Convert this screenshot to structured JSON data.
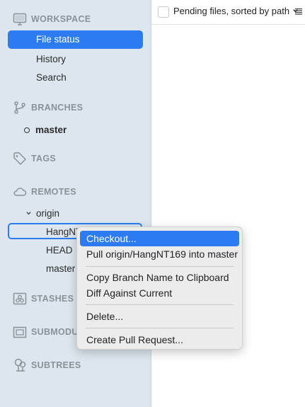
{
  "sidebar": {
    "workspace": {
      "header": "WORKSPACE",
      "items": [
        "File status",
        "History",
        "Search"
      ]
    },
    "branches": {
      "header": "BRANCHES",
      "current": "master"
    },
    "tags": {
      "header": "TAGS"
    },
    "remotes": {
      "header": "REMOTES",
      "remote_name": "origin",
      "branches": [
        "HangNT169",
        "HEAD",
        "master"
      ],
      "truncated_first": "HangNT"
    },
    "stashes": {
      "header": "STASHES"
    },
    "submodules": {
      "header": "SUBMODULES",
      "truncated": "SUBMODUL"
    },
    "subtrees": {
      "header": "SUBTREES"
    }
  },
  "toolbar": {
    "sort_label": "Pending files, sorted by path"
  },
  "context_menu": {
    "items": [
      "Checkout...",
      "Pull origin/HangNT169 into master",
      "Copy Branch Name to Clipboard",
      "Diff Against Current",
      "Delete...",
      "Create Pull Request..."
    ],
    "highlighted": "Checkout..."
  },
  "colors": {
    "accent": "#2d7bf0",
    "sidebar_bg": "#dde6ee",
    "section_header": "#8a9198"
  },
  "icons": {
    "workspace": "monitor-icon",
    "branches": "branch-icon",
    "tags": "tag-icon",
    "remotes": "cloud-icon",
    "stashes": "stash-icon",
    "submodules": "submodule-icon",
    "subtrees": "subtree-icon"
  }
}
